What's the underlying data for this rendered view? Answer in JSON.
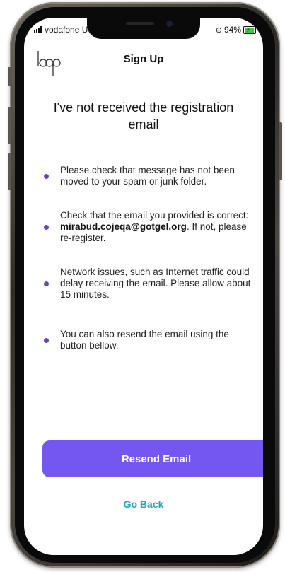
{
  "status_bar": {
    "carrier": "vodafone U",
    "battery_percent": "94%"
  },
  "header": {
    "logo_text": "loop",
    "title": "Sign Up"
  },
  "main": {
    "title": "I've not received the registration email",
    "bullets": [
      {
        "text": "Please check that message has not been moved to your spam or junk folder."
      },
      {
        "text_before": "Check that the email you provided is correct: ",
        "email": "mirabud.cojeqa@gotgel.org",
        "text_after": ". If not, please re-register."
      },
      {
        "text": "Network issues, such as Internet traffic could delay receiving the email. Please allow about 15 minutes."
      },
      {
        "text": "You can also resend the email using the button bellow."
      }
    ]
  },
  "actions": {
    "resend_label": "Resend Email",
    "goback_label": "Go Back"
  },
  "colors": {
    "accent": "#7357f0",
    "bullet": "#6f3fbf",
    "link": "#21a4b5"
  }
}
